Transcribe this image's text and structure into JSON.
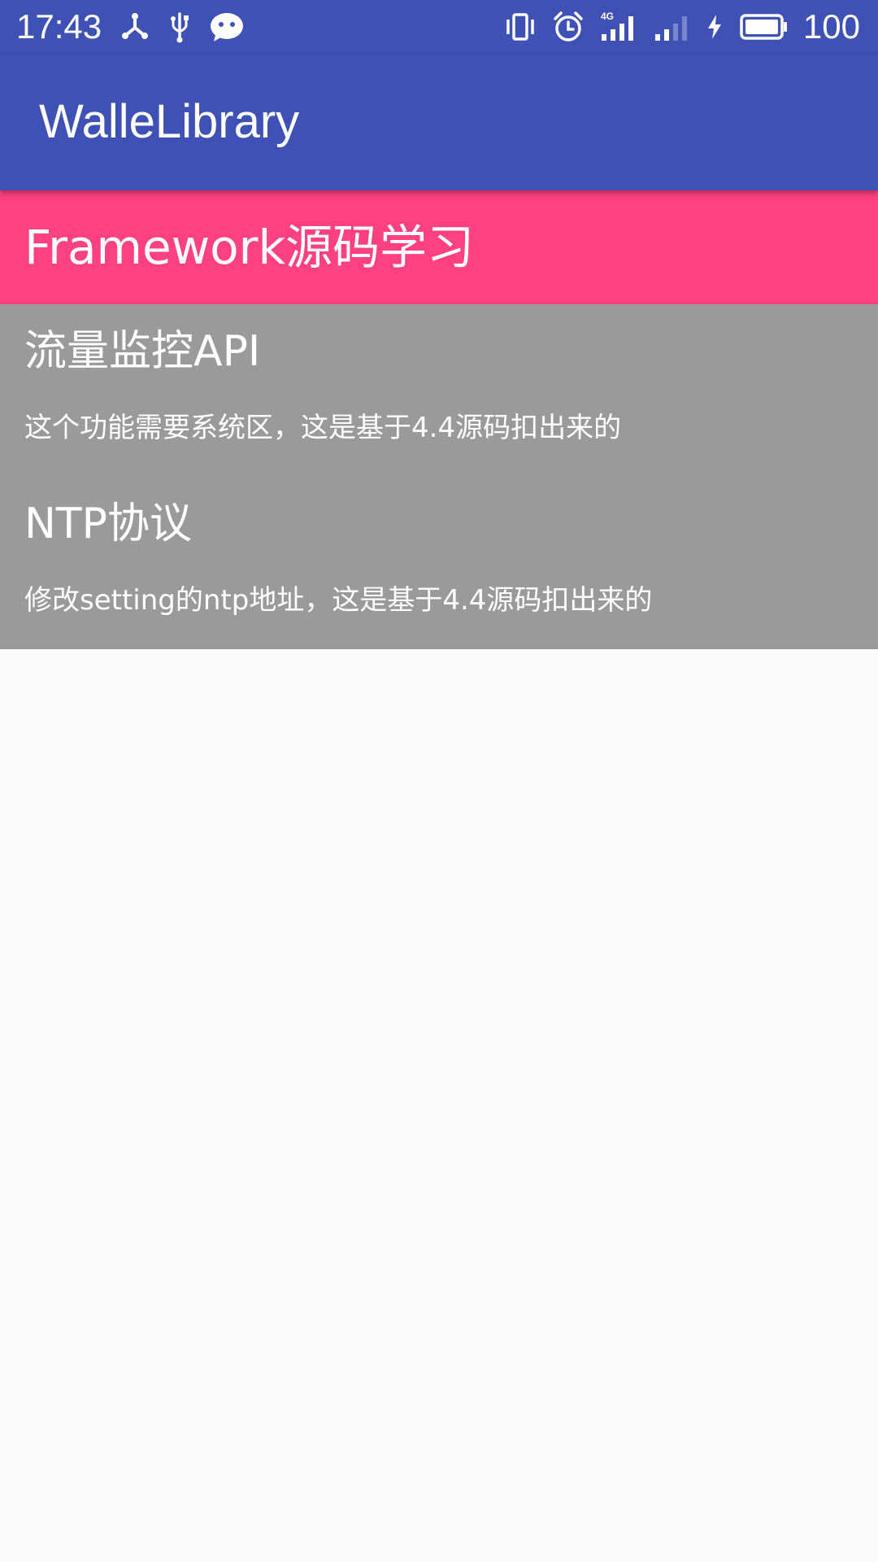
{
  "status_bar": {
    "time": "17:43",
    "battery_level": "100",
    "left_icons": [
      "usb-debug-icon",
      "usb-icon",
      "wechat-icon"
    ],
    "right_icons": [
      "vibrate-icon",
      "alarm-icon",
      "signal-4g-icon",
      "signal-icon",
      "charging-icon",
      "battery-icon"
    ],
    "background": "#3f51b5"
  },
  "app_bar": {
    "title": "WalleLibrary",
    "background": "#3f51b5"
  },
  "section": {
    "title": "Framework源码学习",
    "background": "#ff4081"
  },
  "list": {
    "background": "#9a9a9a",
    "items": [
      {
        "title": "流量监控API",
        "description": "这个功能需要系统区，这是基于4.4源码扣出来的"
      },
      {
        "title": "NTP协议",
        "description": "修改setting的ntp地址，这是基于4.4源码扣出来的"
      }
    ]
  },
  "page": {
    "background": "#fafafa"
  }
}
